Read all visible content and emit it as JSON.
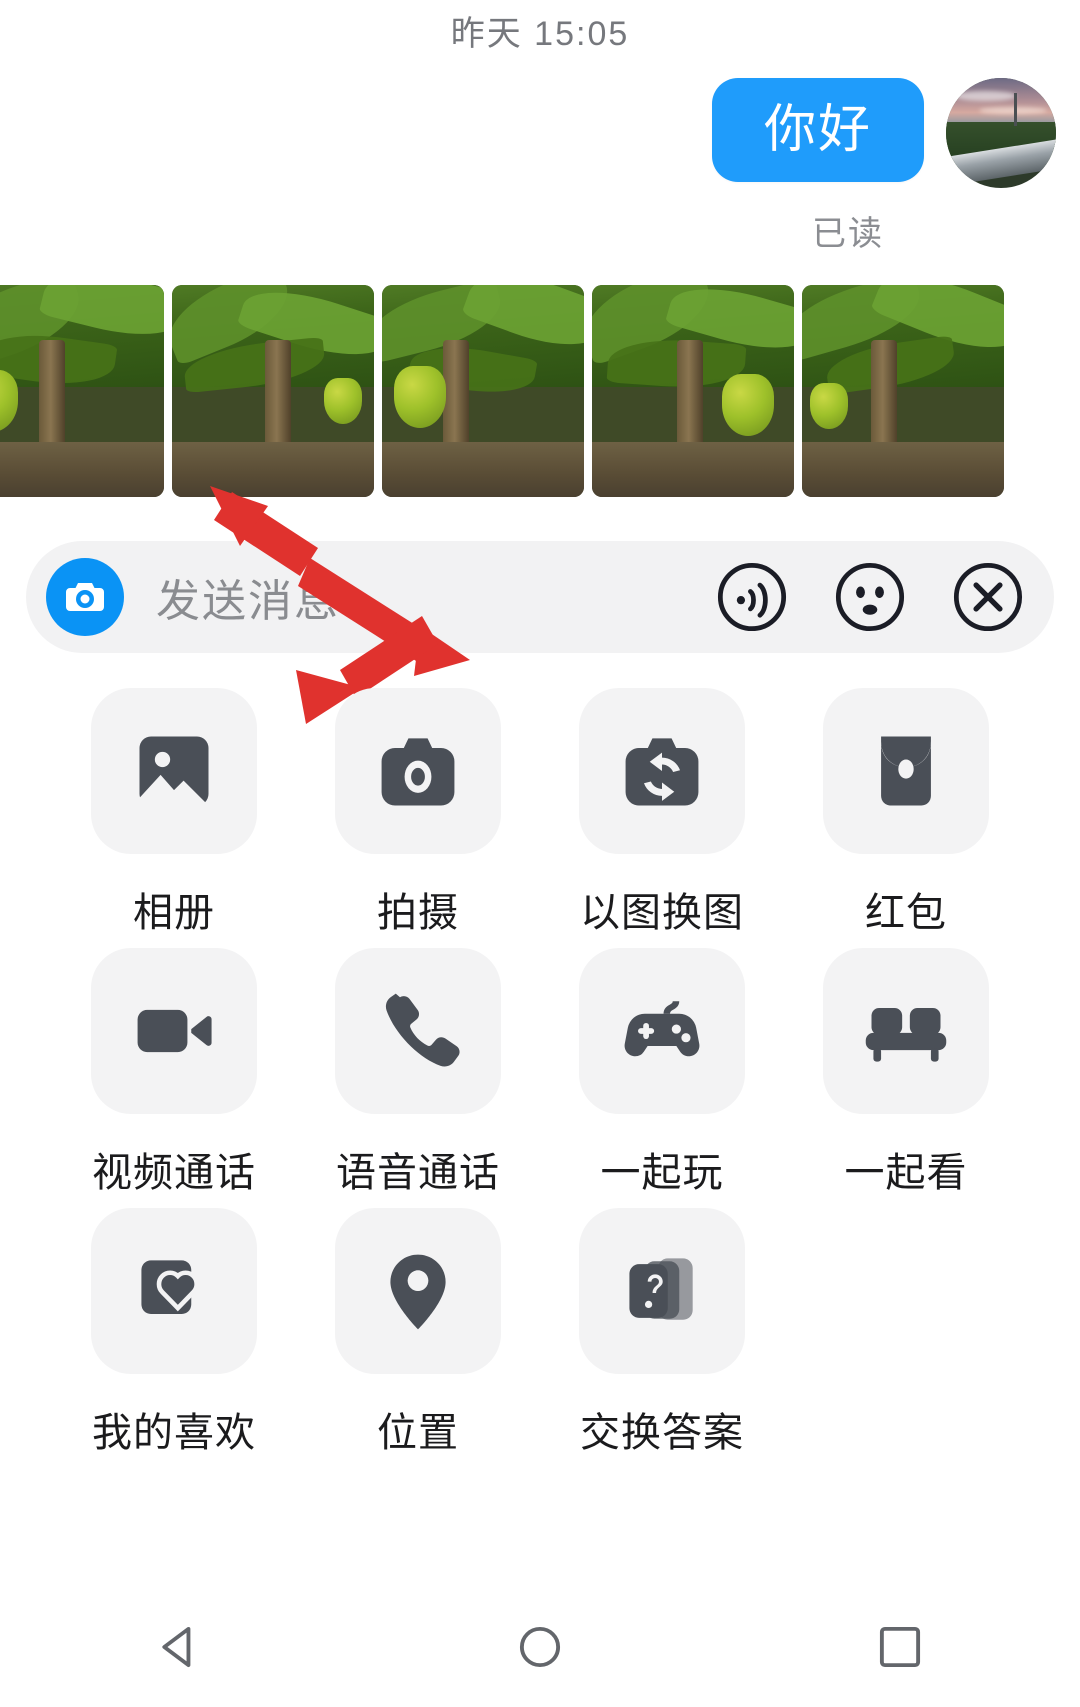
{
  "chat": {
    "timestamp": "昨天 15:05",
    "message": {
      "text": "你好",
      "bubble_color": "#1f9cfb",
      "status": "已读"
    },
    "avatar_name": "user-avatar-sunset-road"
  },
  "photo_strip": {
    "name": "banana-plantation-photo-strip",
    "photos": [
      {
        "alt": "banana-plantation-1"
      },
      {
        "alt": "banana-plantation-2"
      },
      {
        "alt": "banana-plantation-3"
      },
      {
        "alt": "banana-plantation-4"
      },
      {
        "alt": "banana-plantation-5"
      }
    ]
  },
  "input_bar": {
    "camera_icon": "camera-shutter-icon",
    "placeholder": "发送消息",
    "actions": [
      {
        "icon": "voice-wave-icon"
      },
      {
        "icon": "emoji-face-icon"
      },
      {
        "icon": "close-x-icon"
      }
    ]
  },
  "annotation": {
    "arrow_color": "#e0322e",
    "name": "red-double-arrow-annotation"
  },
  "app_grid": {
    "items": [
      {
        "label": "相册",
        "icon": "photo-album-icon"
      },
      {
        "label": "拍摄",
        "icon": "camera-icon"
      },
      {
        "label": "以图换图",
        "icon": "image-swap-icon"
      },
      {
        "label": "红包",
        "icon": "red-packet-icon"
      },
      {
        "label": "视频通话",
        "icon": "video-call-icon"
      },
      {
        "label": "语音通话",
        "icon": "voice-call-icon"
      },
      {
        "label": "一起玩",
        "icon": "game-controller-icon"
      },
      {
        "label": "一起看",
        "icon": "sofa-watch-together-icon"
      },
      {
        "label": "我的喜欢",
        "icon": "favorites-heart-icon"
      },
      {
        "label": "位置",
        "icon": "location-pin-icon"
      },
      {
        "label": "交换答案",
        "icon": "question-cards-icon"
      }
    ]
  },
  "navbar": {
    "buttons": [
      {
        "name": "back-button"
      },
      {
        "name": "home-button"
      },
      {
        "name": "recents-button"
      }
    ]
  }
}
